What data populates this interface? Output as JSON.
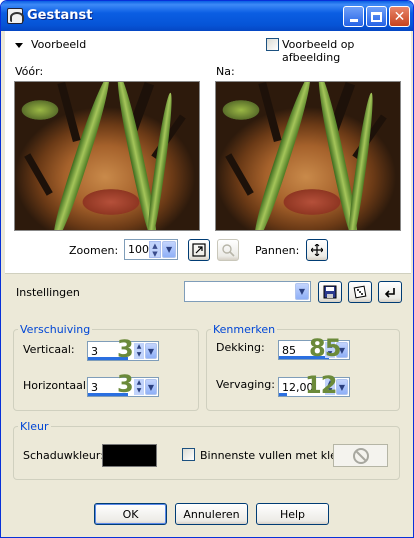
{
  "window": {
    "title": "Gestanst"
  },
  "preview": {
    "toggle_label": "Voorbeeld",
    "on_image_label": "Voorbeeld op afbeelding",
    "before_label": "Vóór:",
    "after_label": "Na:",
    "zoom_label": "Zoomen:",
    "zoom_value": "100",
    "pan_label": "Pannen:"
  },
  "settings": {
    "label": "Instellingen",
    "preset_value": ""
  },
  "offset": {
    "legend": "Verschuiving",
    "vertical_label": "Verticaal:",
    "vertical_value": "3",
    "vertical_overlay": "3",
    "horizontal_label": "Horizontaal:",
    "horizontal_value": "3",
    "horizontal_overlay": "3"
  },
  "attributes": {
    "legend": "Kenmerken",
    "opacity_label": "Dekking:",
    "opacity_value": "85",
    "opacity_overlay": "85",
    "blur_label": "Vervaging:",
    "blur_value": "12,00",
    "blur_overlay": "12"
  },
  "color": {
    "legend": "Kleur",
    "shadow_label": "Schaduwkleur:",
    "shadow_color": "#000000",
    "fill_label": "Binnenste vullen met kleur:"
  },
  "buttons": {
    "ok": "OK",
    "cancel": "Annuleren",
    "help": "Help"
  }
}
